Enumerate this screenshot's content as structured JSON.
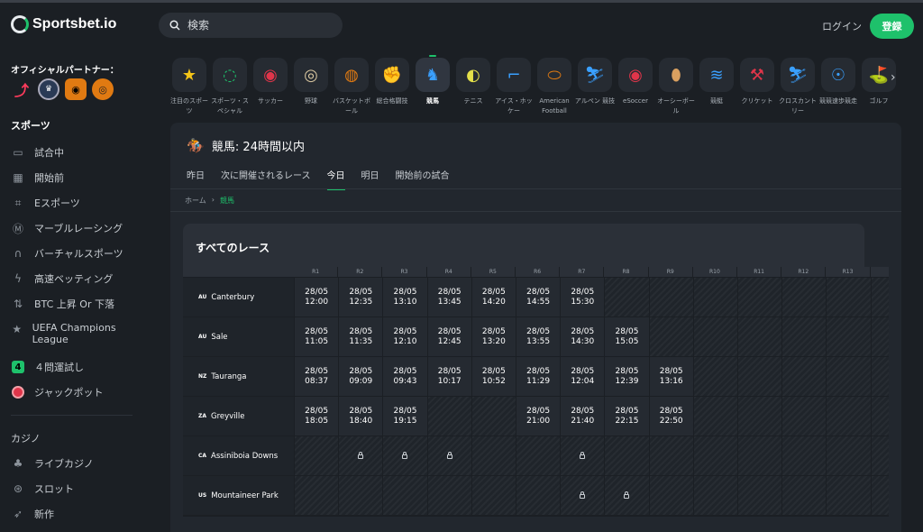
{
  "brand": {
    "name": "Sportsbet.io"
  },
  "search": {
    "placeholder": "検索"
  },
  "header": {
    "login": "ログイン",
    "register": "登録"
  },
  "partners": {
    "title": "オフィシャルパートナー："
  },
  "sidebar": {
    "sports_title": "スポーツ",
    "sports": [
      {
        "label": "試合中",
        "icon": "monitor-icon"
      },
      {
        "label": "開始前",
        "icon": "calendar-icon"
      },
      {
        "label": "Eスポーツ",
        "icon": "gamepad-icon"
      },
      {
        "label": "マーブルレーシング",
        "icon": "marble-icon"
      },
      {
        "label": "バーチャルスポーツ",
        "icon": "headset-icon"
      },
      {
        "label": "高速ベッティング",
        "icon": "lightning-icon"
      },
      {
        "label": "BTC 上昇 Or 下落",
        "icon": "updown-icon"
      },
      {
        "label": "UEFA Champions League",
        "icon": "star-icon"
      },
      {
        "label": "４問運試し",
        "icon": "four-badge-icon"
      },
      {
        "label": "ジャックポット",
        "icon": "jackpot-icon"
      }
    ],
    "casino_title": "カジノ",
    "casino": [
      {
        "label": "ライブカジノ",
        "icon": "live-casino-icon"
      },
      {
        "label": "スロット",
        "icon": "slots-icon"
      },
      {
        "label": "新作",
        "icon": "rocket-icon"
      }
    ]
  },
  "sports_strip": [
    {
      "label": "注目のスポーツ",
      "icon": "star-icon",
      "color": "#f5c518"
    },
    {
      "label": "スポーツ・スペシャル",
      "icon": "special-icon",
      "color": "#1ec16b"
    },
    {
      "label": "サッカー",
      "icon": "soccer-icon",
      "color": "#e0354a"
    },
    {
      "label": "野球",
      "icon": "baseball-icon",
      "color": "#d9c7a0"
    },
    {
      "label": "バスケットボール",
      "icon": "basketball-icon",
      "color": "#e07a12"
    },
    {
      "label": "総合格闘技",
      "icon": "mma-icon",
      "color": "#c9ced3"
    },
    {
      "label": "競馬",
      "icon": "horse-racing-icon",
      "color": "#3aa0ff",
      "active": true
    },
    {
      "label": "テニス",
      "icon": "tennis-icon",
      "color": "#e4e04a"
    },
    {
      "label": "アイス・ホッケー",
      "icon": "ice-hockey-icon",
      "color": "#3aa0ff"
    },
    {
      "label": "American Football",
      "icon": "american-football-icon",
      "color": "#e07a12"
    },
    {
      "label": "アルペン 競技",
      "icon": "ski-icon",
      "color": "#3aa0ff"
    },
    {
      "label": "eSoccer",
      "icon": "esoccer-icon",
      "color": "#e0354a"
    },
    {
      "label": "オーシーボール",
      "icon": "aussie-rules-icon",
      "color": "#d9a060"
    },
    {
      "label": "競艇",
      "icon": "boat-icon",
      "color": "#3aa0ff"
    },
    {
      "label": "クリケット",
      "icon": "cricket-icon",
      "color": "#e0354a"
    },
    {
      "label": "クロスカントリー",
      "icon": "cross-country-icon",
      "color": "#3aa0ff"
    },
    {
      "label": "競競速歩競走",
      "icon": "cycling-icon",
      "color": "#3aa0ff"
    },
    {
      "label": "ゴルフ",
      "icon": "golf-icon",
      "color": "#1ec16b"
    }
  ],
  "panel": {
    "title": "競馬: 24時間以内",
    "tabs": [
      "昨日",
      "次に開催されるレース",
      "今日",
      "明日",
      "開始前の試合"
    ],
    "active_tab": 2,
    "breadcrumb": [
      "ホーム",
      "競馬"
    ],
    "races_title": "すべてのレース"
  },
  "table": {
    "columns": [
      "R1",
      "R2",
      "R3",
      "R4",
      "R5",
      "R6",
      "R7",
      "R8",
      "R9",
      "R10",
      "R11",
      "R12",
      "R13"
    ],
    "rows": [
      {
        "cc": "AU",
        "venue": "Canterbury",
        "cells": [
          [
            "28/05",
            "12:00"
          ],
          [
            "28/05",
            "12:35"
          ],
          [
            "28/05",
            "13:10"
          ],
          [
            "28/05",
            "13:45"
          ],
          [
            "28/05",
            "14:20"
          ],
          [
            "28/05",
            "14:55"
          ],
          [
            "28/05",
            "15:30"
          ],
          null,
          null,
          null,
          null,
          null,
          null
        ]
      },
      {
        "cc": "AU",
        "venue": "Sale",
        "cells": [
          [
            "28/05",
            "11:05"
          ],
          [
            "28/05",
            "11:35"
          ],
          [
            "28/05",
            "12:10"
          ],
          [
            "28/05",
            "12:45"
          ],
          [
            "28/05",
            "13:20"
          ],
          [
            "28/05",
            "13:55"
          ],
          [
            "28/05",
            "14:30"
          ],
          [
            "28/05",
            "15:05"
          ],
          null,
          null,
          null,
          null,
          null
        ]
      },
      {
        "cc": "NZ",
        "venue": "Tauranga",
        "cells": [
          [
            "28/05",
            "08:37"
          ],
          [
            "28/05",
            "09:09"
          ],
          [
            "28/05",
            "09:43"
          ],
          [
            "28/05",
            "10:17"
          ],
          [
            "28/05",
            "10:52"
          ],
          [
            "28/05",
            "11:29"
          ],
          [
            "28/05",
            "12:04"
          ],
          [
            "28/05",
            "12:39"
          ],
          [
            "28/05",
            "13:16"
          ],
          null,
          null,
          null,
          null
        ]
      },
      {
        "cc": "ZA",
        "venue": "Greyville",
        "cells": [
          [
            "28/05",
            "18:05"
          ],
          [
            "28/05",
            "18:40"
          ],
          [
            "28/05",
            "19:15"
          ],
          null,
          null,
          [
            "28/05",
            "21:00"
          ],
          [
            "28/05",
            "21:40"
          ],
          [
            "28/05",
            "22:15"
          ],
          [
            "28/05",
            "22:50"
          ],
          null,
          null,
          null,
          null
        ]
      },
      {
        "cc": "CA",
        "venue": "Assiniboia Downs",
        "cells": [
          null,
          "lock",
          "lock",
          "lock",
          null,
          null,
          "lock",
          null,
          null,
          null,
          null,
          null,
          null
        ]
      },
      {
        "cc": "US",
        "venue": "Mountaineer Park",
        "cells": [
          null,
          null,
          null,
          null,
          null,
          null,
          "lock",
          "lock",
          null,
          null,
          null,
          null,
          null
        ]
      }
    ]
  }
}
